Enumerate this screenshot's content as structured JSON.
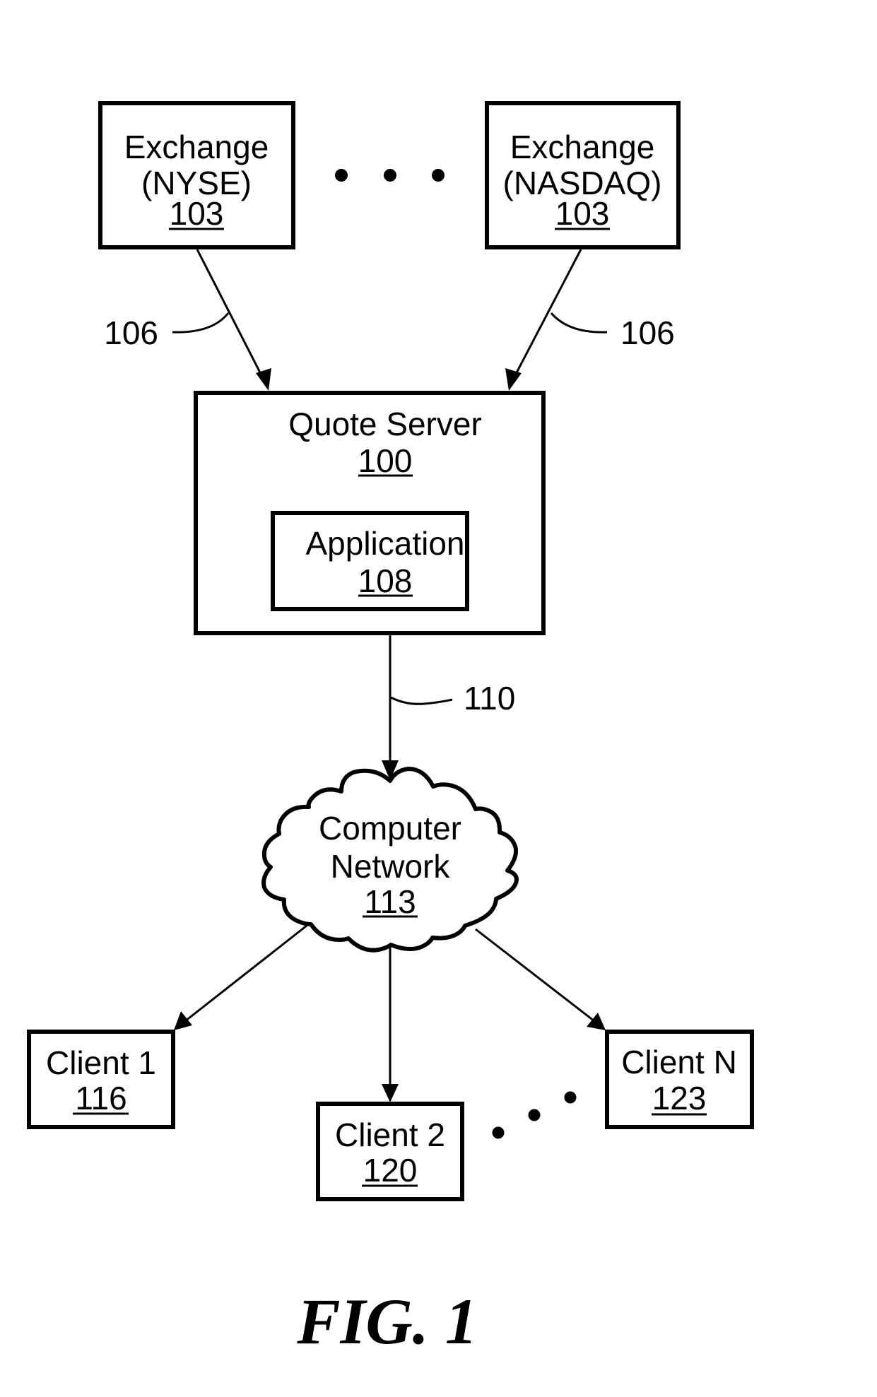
{
  "figure": {
    "caption": "FIG. 1"
  },
  "nodes": {
    "exchange_nyse": {
      "lines": [
        "Exchange",
        "(NYSE)"
      ],
      "ref": "103"
    },
    "exchange_nasdaq": {
      "lines": [
        "Exchange",
        "(NASDAQ)"
      ],
      "ref": "103"
    },
    "quote_server": {
      "lines": [
        "Quote Server"
      ],
      "ref": "100"
    },
    "application": {
      "lines": [
        "Application"
      ],
      "ref": "108"
    },
    "computer_network": {
      "lines": [
        "Computer",
        "Network"
      ],
      "ref": "113",
      "shape": "cloud"
    },
    "client_1": {
      "lines": [
        "Client 1"
      ],
      "ref": "116"
    },
    "client_2": {
      "lines": [
        "Client 2"
      ],
      "ref": "120"
    },
    "client_n": {
      "lines": [
        "Client N"
      ],
      "ref": "123"
    }
  },
  "connections": [
    {
      "from": "exchange_nyse",
      "to": "quote_server",
      "ref": "106"
    },
    {
      "from": "exchange_nasdaq",
      "to": "quote_server",
      "ref": "106"
    },
    {
      "from": "quote_server",
      "to": "computer_network",
      "ref": "110"
    },
    {
      "from": "computer_network",
      "to": "client_1",
      "ref": ""
    },
    {
      "from": "computer_network",
      "to": "client_2",
      "ref": ""
    },
    {
      "from": "computer_network",
      "to": "client_n",
      "ref": ""
    }
  ],
  "ellipses": {
    "between_exchanges": "horizontal-dots",
    "between_clients": "diagonal-dots"
  }
}
